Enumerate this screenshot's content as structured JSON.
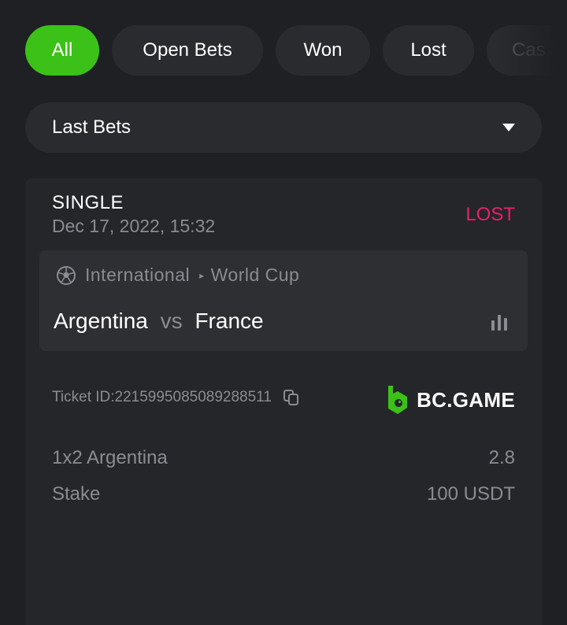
{
  "filters": {
    "tabs": [
      {
        "label": "All",
        "active": true
      },
      {
        "label": "Open Bets",
        "active": false
      },
      {
        "label": "Won",
        "active": false
      },
      {
        "label": "Lost",
        "active": false
      },
      {
        "label": "Cas",
        "active": false
      }
    ]
  },
  "dropdown": {
    "selected": "Last Bets"
  },
  "bet": {
    "type": "SINGLE",
    "date": "Dec 17, 2022, 15:32",
    "status": "LOST",
    "event": {
      "sport_icon": "soccer-ball-icon",
      "category": "International",
      "league": "World Cup",
      "separator": "▸",
      "home": "Argentina",
      "vs": "vs",
      "away": "France"
    },
    "ticket": {
      "label": "Ticket ID: ",
      "id": "2215995085089288511"
    },
    "brand": "BC.GAME",
    "market": {
      "label": "1x2 Argentina",
      "odds": "2.8"
    },
    "stake": {
      "label": "Stake",
      "value": "100 USDT"
    }
  },
  "colors": {
    "background": "#1f2023",
    "surface": "#2a2b2f",
    "card": "#25262a",
    "active": "#3bc117",
    "lost": "#ed1d6b",
    "muted": "#8a8c91"
  }
}
